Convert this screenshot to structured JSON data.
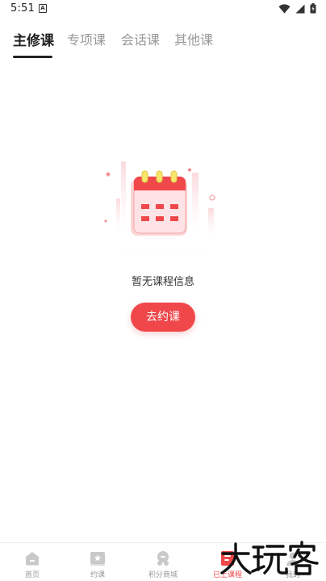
{
  "status_bar": {
    "time": "5:51",
    "notification_badge": "A"
  },
  "tabs": [
    {
      "label": "主修课",
      "active": true
    },
    {
      "label": "专项课",
      "active": false
    },
    {
      "label": "会话课",
      "active": false
    },
    {
      "label": "其他课",
      "active": false
    }
  ],
  "empty_state": {
    "icon": "calendar-icon",
    "message": "暂无课程信息",
    "button_label": "去约课"
  },
  "bottom_nav": {
    "items": [
      {
        "label": "首页",
        "icon": "home-icon",
        "active": false
      },
      {
        "label": "约课",
        "icon": "book-class-icon",
        "active": false
      },
      {
        "label": "积分商城",
        "icon": "points-mall-icon",
        "active": false
      },
      {
        "label": "已上课程",
        "icon": "attended-courses-icon",
        "active": true
      },
      {
        "label": "我的",
        "icon": "profile-icon",
        "active": false
      }
    ]
  },
  "watermark": {
    "text": "大玩客"
  },
  "colors": {
    "accent": "#f0474b",
    "text_primary": "#222222",
    "text_secondary": "#999999"
  }
}
